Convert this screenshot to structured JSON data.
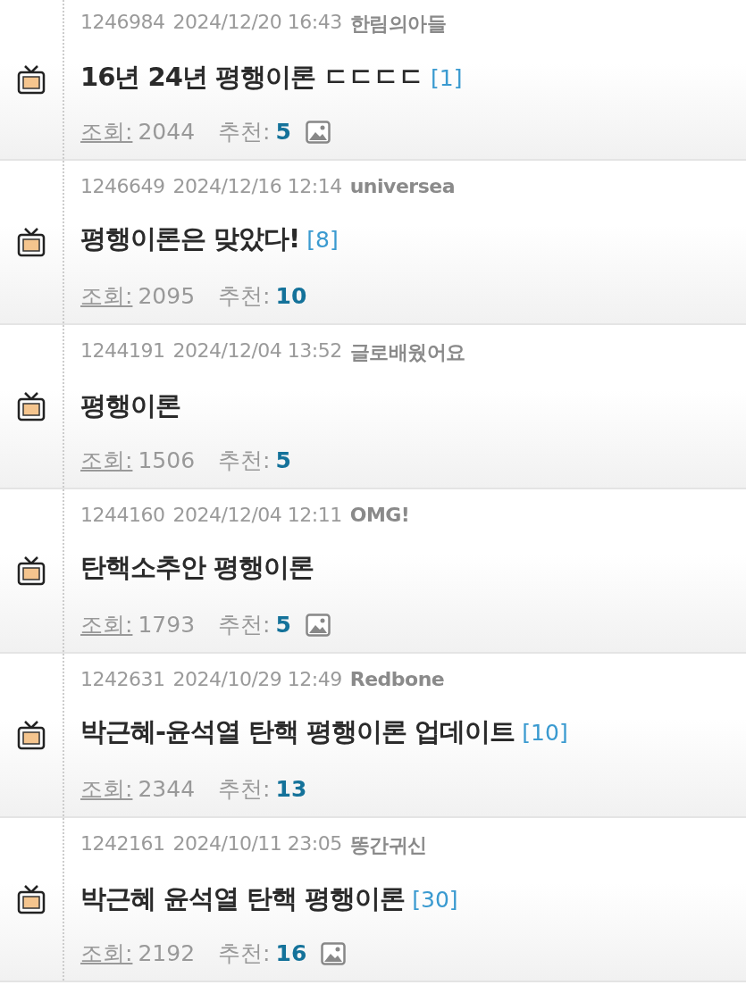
{
  "posts": [
    {
      "number": "1246984",
      "date": "2024/12/20 16:43",
      "author": "한림의아들",
      "title": "16년 24년 평행이론 ㄷㄷㄷㄷ",
      "comments": "[1]",
      "views_label": "조회:",
      "views": "2044",
      "likes_label": "추천:",
      "likes": "5",
      "has_image": true
    },
    {
      "number": "1246649",
      "date": "2024/12/16 12:14",
      "author": "universea",
      "title": "평행이론은 맞았다!",
      "comments": "[8]",
      "views_label": "조회:",
      "views": "2095",
      "likes_label": "추천:",
      "likes": "10",
      "has_image": false
    },
    {
      "number": "1244191",
      "date": "2024/12/04 13:52",
      "author": "글로배웠어요",
      "title": "평행이론",
      "views_label": "조회:",
      "views": "1506",
      "likes_label": "추천:",
      "likes": "5",
      "has_image": false
    },
    {
      "number": "1244160",
      "date": "2024/12/04 12:11",
      "author": "OMG!",
      "title": "탄핵소추안 평행이론",
      "views_label": "조회:",
      "views": "1793",
      "likes_label": "추천:",
      "likes": "5",
      "has_image": true
    },
    {
      "number": "1242631",
      "date": "2024/10/29 12:49",
      "author": "Redbone",
      "title": "박근혜-윤석열 탄핵 평행이론 업데이트",
      "comments": "[10]",
      "views_label": "조회:",
      "views": "2344",
      "likes_label": "추천:",
      "likes": "13",
      "has_image": false
    },
    {
      "number": "1242161",
      "date": "2024/10/11 23:05",
      "author": "똥간귀신",
      "title": "박근혜 윤석열 탄핵 평행이론",
      "comments": "[30]",
      "views_label": "조회:",
      "views": "2192",
      "likes_label": "추천:",
      "likes": "16",
      "has_image": true
    }
  ]
}
